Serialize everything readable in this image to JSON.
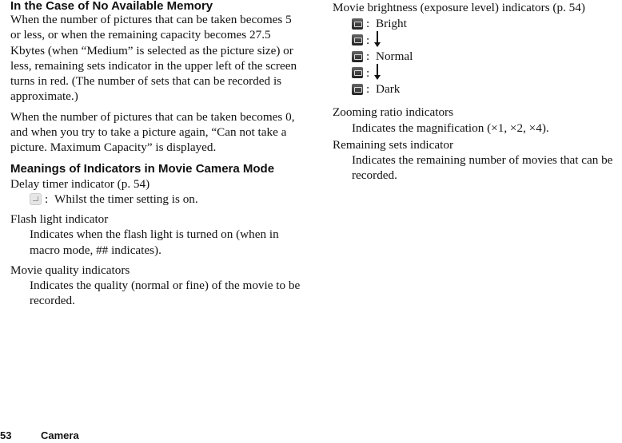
{
  "left": {
    "heading1": "In the Case of No Available Memory",
    "para1": "When the number of pictures that can be taken becomes 5 or less, or when the remaining capacity becomes 27.5 Kbytes (when “Medium” is selected as the picture size) or less, remaining sets indicator in the upper left of the screen turns in red. (The number of sets that can be recorded is approximate.)",
    "para2": "When the number of pictures that can be taken becomes 0, and when you try to take a picture again, “Can not take a picture. Maximum Capacity” is displayed.",
    "heading2": "Meanings of Indicators in Movie Camera Mode",
    "delay_title": "Delay timer indicator (p. 54)",
    "delay_desc": "Whilst the timer setting is on.",
    "flash_title": "Flash light indicator",
    "flash_desc": "Indicates when the flash light is turned on (when in macro mode, ## indicates).",
    "quality_title": "Movie quality indicators",
    "quality_desc": "Indicates the quality (normal or fine) of the movie to be recorded."
  },
  "right": {
    "brightness_title": "Movie brightness (exposure level) indicators (p. 54)",
    "brightness_levels": [
      {
        "icon": "brightness-icon",
        "label": "Bright"
      },
      {
        "icon": "brightness-icon",
        "label": ""
      },
      {
        "icon": "brightness-icon",
        "label": "Normal"
      },
      {
        "icon": "brightness-icon",
        "label": ""
      },
      {
        "icon": "brightness-icon",
        "label": "Dark"
      }
    ],
    "colon": ":",
    "zoom_title": "Zooming ratio indicators",
    "zoom_desc": "Indicates the magnification (×1, ×2, ×4).",
    "remaining_title": "Remaining sets indicator",
    "remaining_desc": "Indicates the remaining number of movies that can be recorded."
  },
  "footer": {
    "page_number": "53",
    "section": "Camera"
  }
}
